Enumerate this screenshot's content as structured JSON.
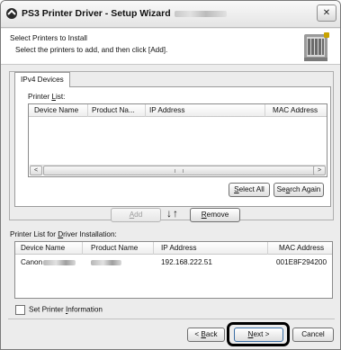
{
  "window": {
    "title": "PS3 Printer Driver - Setup Wizard",
    "close_glyph": "✕"
  },
  "header": {
    "title": "Select Printers to Install",
    "subtitle": "Select the printers to add, and then click [Add]."
  },
  "tab": {
    "label": "IPv4 Devices"
  },
  "printer_list": {
    "label_prefix": "Printer ",
    "label_key": "L",
    "label_suffix": "ist:",
    "columns": [
      "Device Name",
      "Product Na...",
      "IP Address",
      "MAC Address"
    ],
    "rows": []
  },
  "scroll": {
    "left": "<",
    "right": ">"
  },
  "buttons": {
    "select_all": {
      "pre": "",
      "key": "S",
      "post": "elect All"
    },
    "search_again": {
      "pre": "Se",
      "key": "a",
      "post": "rch Again"
    },
    "add": {
      "pre": "",
      "key": "A",
      "post": "dd"
    },
    "remove": {
      "pre": "",
      "key": "R",
      "post": "emove"
    },
    "back": {
      "pre": "< ",
      "key": "B",
      "post": "ack"
    },
    "next": {
      "pre": "",
      "key": "N",
      "post": "ext >"
    },
    "cancel": "Cancel"
  },
  "move_arrows": "↓↑",
  "install_list": {
    "label_prefix": "Printer List for ",
    "label_key": "D",
    "label_suffix": "river Installation:",
    "columns": [
      "Device Name",
      "Product Name",
      "IP Address",
      "MAC Address"
    ],
    "rows": [
      {
        "device_name": "Canon",
        "product_name": "",
        "ip_address": "192.168.222.51",
        "mac_address": "001E8F294200"
      }
    ]
  },
  "set_printer_info": {
    "pre": "Set Printer ",
    "key": "I",
    "post": "nformation",
    "checked": false
  },
  "colors": {
    "window_bg": "#ececec",
    "panel_bg": "#ffffff",
    "highlight_ring": "#000000"
  }
}
